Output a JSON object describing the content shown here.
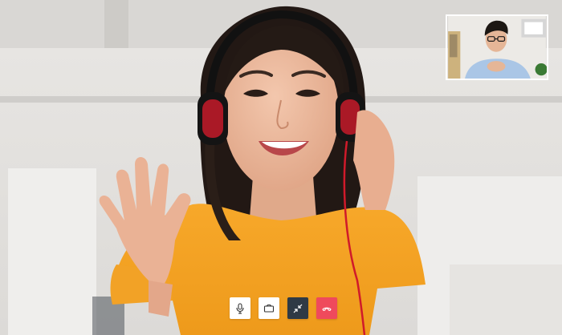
{
  "call": {
    "main_participant": "woman-with-headset",
    "self_participant": "man-with-glasses"
  },
  "controls": [
    {
      "name": "mic-button",
      "icon": "microphone-icon"
    },
    {
      "name": "camera-button",
      "icon": "video-camera-icon"
    },
    {
      "name": "minimize-button",
      "icon": "minimize-arrows-icon"
    },
    {
      "name": "end-call-button",
      "icon": "hang-up-phone-icon"
    }
  ],
  "colors": {
    "button_light": "#ffffff",
    "button_dark": "#2f3a45",
    "button_end": "#ef4a5c",
    "shirt": "#f5a623"
  }
}
